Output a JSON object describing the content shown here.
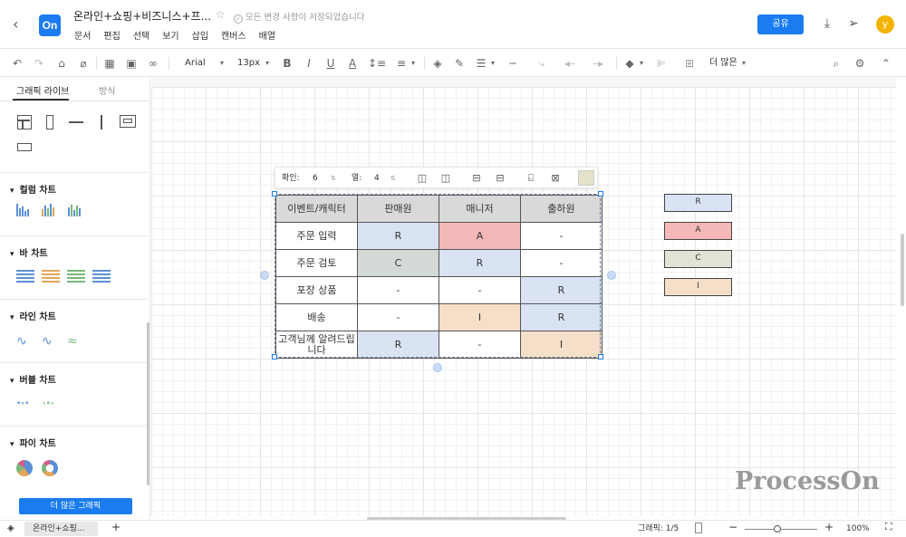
{
  "header": {
    "logo": "On",
    "title": "온라인+쇼핑+비즈니스+프...",
    "save_status": "모든 변경 사항이 저장되었습니다",
    "menu": [
      "문서",
      "편집",
      "선택",
      "보기",
      "삽입",
      "캔버스",
      "배열"
    ],
    "share_label": "공유",
    "avatar_letter": "y"
  },
  "toolbar": {
    "font_family": "Arial",
    "font_size": "13px",
    "more_label": "더 많은"
  },
  "sidebar": {
    "tabs": [
      "그래픽 라이브",
      "방식"
    ],
    "sections": [
      "컬럼 차트",
      "바 차트",
      "라인 차트",
      "버블 차트",
      "파이 차트"
    ],
    "more_button": "더 많은 그래픽"
  },
  "table_toolbar": {
    "rows_label": "확인:",
    "rows_value": "6",
    "cols_label": "열:",
    "cols_value": "4",
    "fill_color": "#e3e2c9"
  },
  "raci_table": {
    "headers": [
      "이벤트/캐릭터",
      "판매원",
      "매니저",
      "출하원"
    ],
    "rows": [
      {
        "task": "주문 입력",
        "cells": [
          "R",
          "A",
          "-"
        ]
      },
      {
        "task": "주문 검토",
        "cells": [
          "C",
          "R",
          "-"
        ]
      },
      {
        "task": "포장 상품",
        "cells": [
          "-",
          "-",
          "R"
        ]
      },
      {
        "task": "배송",
        "cells": [
          "-",
          "I",
          "R"
        ]
      },
      {
        "task": "고객님께 알려드립니다",
        "cells": [
          "R",
          "-",
          "I"
        ]
      }
    ],
    "colors": {
      "R": "#dae3f3",
      "A": "#f4b8b8",
      "C": "#d3d9d5",
      "I": "#f5dfc8",
      "-": "#ffffff"
    }
  },
  "legend": [
    {
      "label": "R",
      "color": "#dae3f3"
    },
    {
      "label": "A",
      "color": "#f4b8b8"
    },
    {
      "label": "C",
      "color": "#e1e3d5"
    },
    {
      "label": "I",
      "color": "#f5dfc8"
    }
  ],
  "watermark": "ProcessOn",
  "statusbar": {
    "page_tab": "온라인+쇼핑...",
    "add_page": "+",
    "graphics_label": "그래픽: 1/5",
    "zoom": "100%"
  }
}
